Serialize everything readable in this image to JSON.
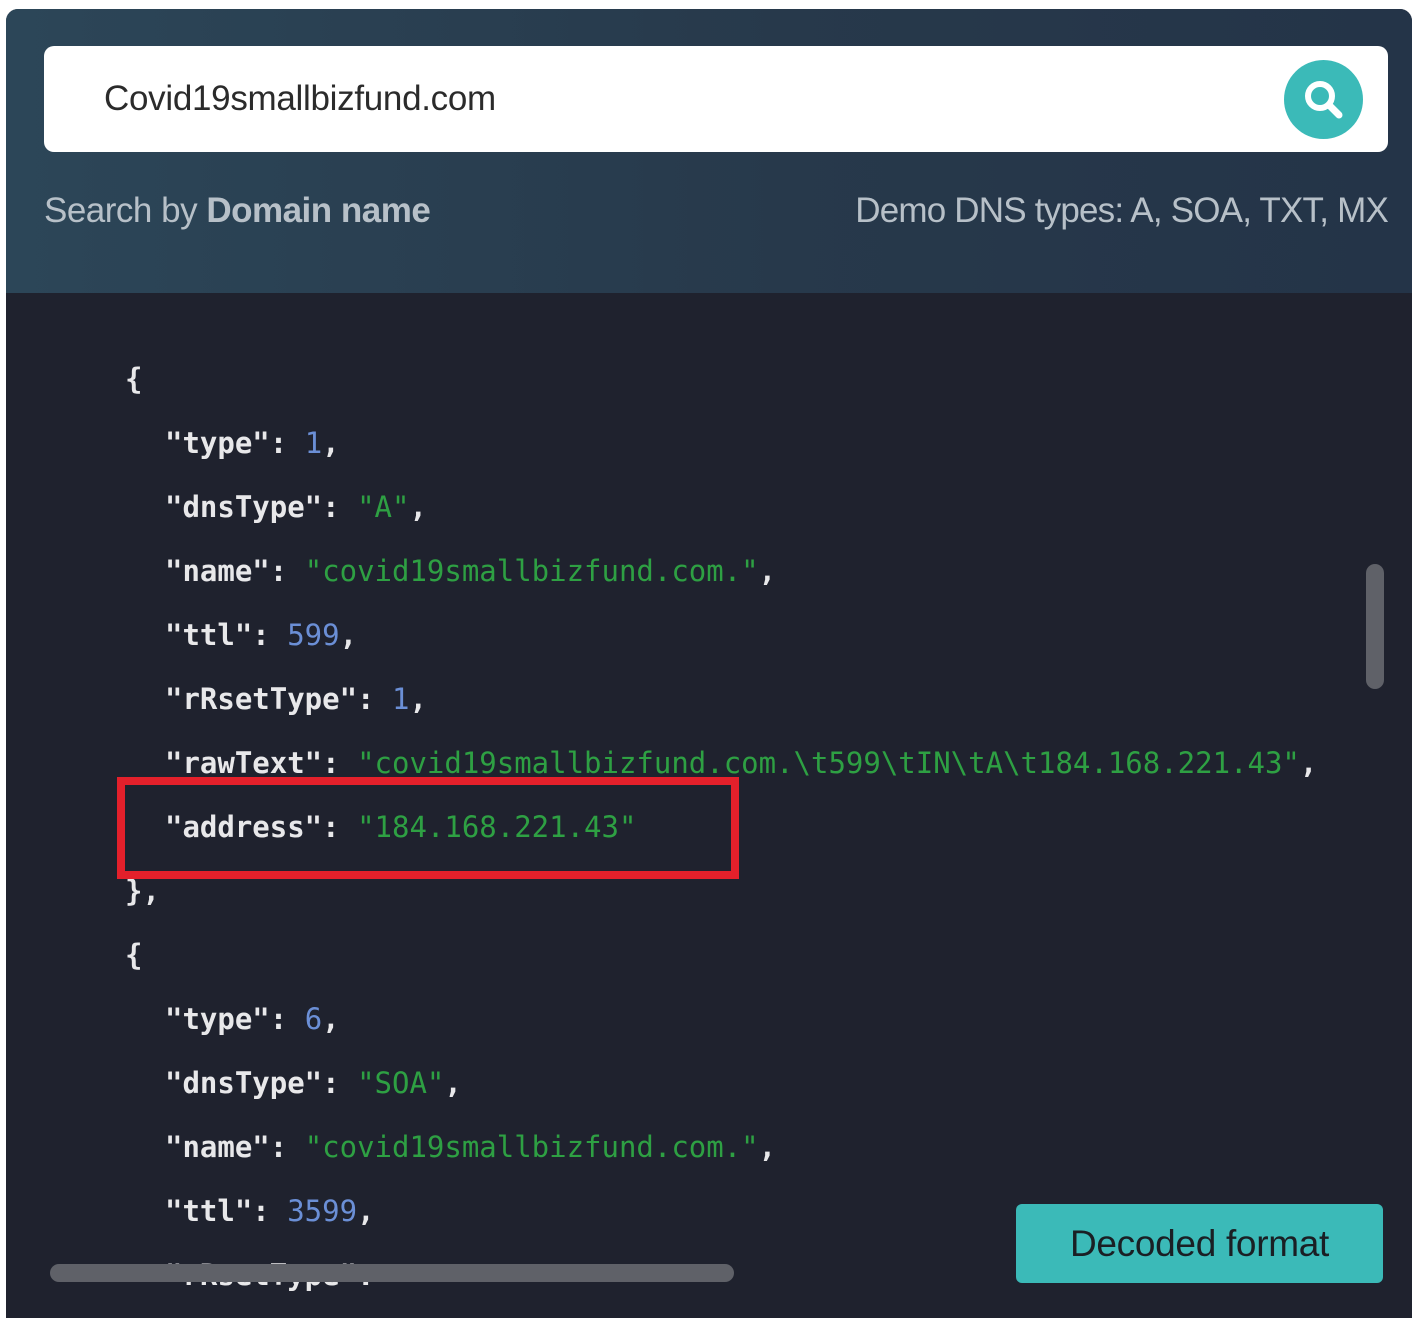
{
  "search": {
    "value": "Covid19smallbizfund.com",
    "hint_prefix": "Search by ",
    "hint_bold": "Domain name",
    "dns_types_note": "Demo DNS types: A, SOA, TXT, MX"
  },
  "code_lines": {
    "open1": "{",
    "r1_type_key": "\"type\": ",
    "r1_type_val": "1",
    "r1_dnstype_key": "\"dnsType\": ",
    "r1_dnstype_val": "\"A\"",
    "r1_name_key": "\"name\": ",
    "r1_name_val": "\"covid19smallbizfund.com.\"",
    "r1_ttl_key": "\"ttl\": ",
    "r1_ttl_val": "599",
    "r1_rrset_key": "\"rRsetType\": ",
    "r1_rrset_val": "1",
    "r1_raw_key": "\"rawText\": ",
    "r1_raw_val": "\"covid19smallbizfund.com.\\t599\\tIN\\tA\\t184.168.221.43\"",
    "r1_addr_key": "\"address\": ",
    "r1_addr_val": "\"184.168.221.43\"",
    "close1": "},",
    "open2": "{",
    "r2_type_key": "\"type\": ",
    "r2_type_val": "6",
    "r2_dnstype_key": "\"dnsType\": ",
    "r2_dnstype_val": "\"SOA\"",
    "r2_name_key": "\"name\": ",
    "r2_name_val": "\"covid19smallbizfund.com.\"",
    "r2_ttl_key": "\"ttl\": ",
    "r2_ttl_val": "3599",
    "r2_next_key": "\"rRsetType\": "
  },
  "decoded_button": "Decoded format",
  "colors": {
    "accent": "#3bbab8",
    "code_background": "#1f222e",
    "string": "#2ea043",
    "number": "#6b8fd6",
    "highlight_box": "#e3202b"
  },
  "icons": {
    "search_button": "magnifier-icon"
  }
}
